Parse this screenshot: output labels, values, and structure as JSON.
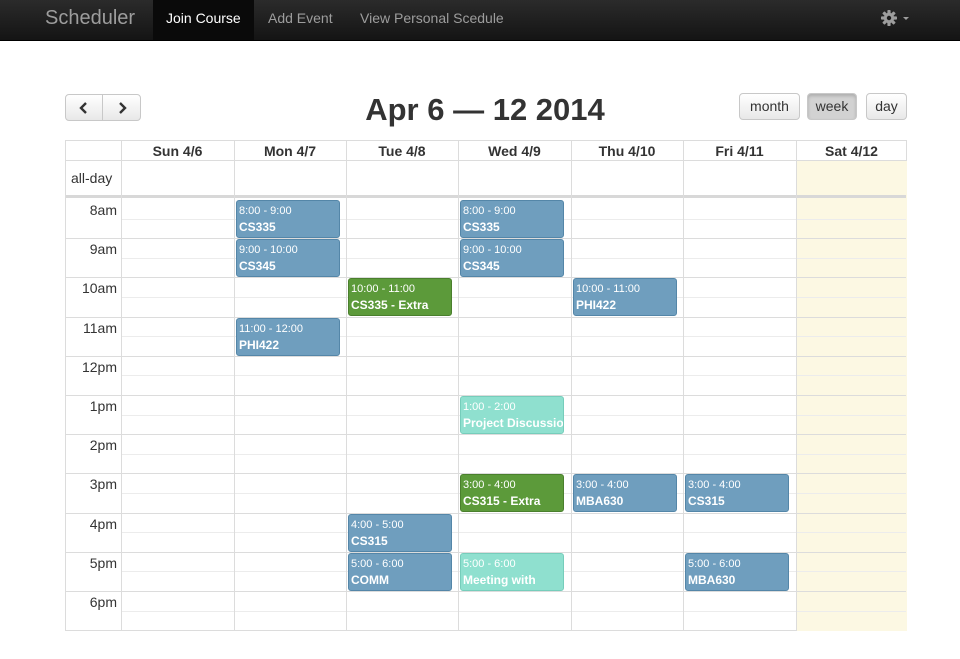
{
  "navbar": {
    "brand": "Scheduler",
    "items": [
      {
        "label": "Join Course",
        "active": true
      },
      {
        "label": "Add Event",
        "active": false
      },
      {
        "label": "View Personal Scedule",
        "active": false
      }
    ],
    "settings_icon": "gear-icon",
    "dropdown_icon": "caret-down-icon"
  },
  "toolbar": {
    "prev_icon": "chevron-left-icon",
    "next_icon": "chevron-right-icon",
    "title": "Apr 6 — 12 2014",
    "views": [
      {
        "label": "month",
        "active": false
      },
      {
        "label": "week",
        "active": true
      },
      {
        "label": "day",
        "active": false
      }
    ]
  },
  "calendar": {
    "days": [
      "Sun 4/6",
      "Mon 4/7",
      "Tue 4/8",
      "Wed 4/9",
      "Thu 4/10",
      "Fri 4/11",
      "Sat 4/12"
    ],
    "today": "Sat 4/12",
    "today_color": "#fcf8e3",
    "allday_label": "all-day",
    "hours": [
      "8am",
      "9am",
      "10am",
      "11am",
      "12pm",
      "1pm",
      "2pm",
      "3pm",
      "4pm",
      "5pm",
      "6pm"
    ],
    "events": [
      {
        "day": 1,
        "start": 8,
        "end": 9,
        "time": "8:00 - 9:00",
        "title": "CS335",
        "color": "blue"
      },
      {
        "day": 1,
        "start": 9,
        "end": 10,
        "time": "9:00 - 10:00",
        "title": "CS345",
        "color": "blue"
      },
      {
        "day": 1,
        "start": 11,
        "end": 12,
        "time": "11:00 - 12:00",
        "title": "PHI422",
        "color": "blue"
      },
      {
        "day": 2,
        "start": 10,
        "end": 11,
        "time": "10:00 - 11:00",
        "title": "CS335 - Extra",
        "color": "green"
      },
      {
        "day": 2,
        "start": 16,
        "end": 17,
        "time": "4:00 - 5:00",
        "title": "CS315",
        "color": "blue"
      },
      {
        "day": 2,
        "start": 17,
        "end": 18,
        "time": "5:00 - 6:00",
        "title": "COMM",
        "color": "blue"
      },
      {
        "day": 3,
        "start": 8,
        "end": 9,
        "time": "8:00 - 9:00",
        "title": "CS335",
        "color": "blue"
      },
      {
        "day": 3,
        "start": 9,
        "end": 10,
        "time": "9:00 - 10:00",
        "title": "CS345",
        "color": "blue"
      },
      {
        "day": 3,
        "start": 13,
        "end": 14,
        "time": "1:00 - 2:00",
        "title": "Project Discussion",
        "color": "teal"
      },
      {
        "day": 3,
        "start": 15,
        "end": 16,
        "time": "3:00 - 4:00",
        "title": "CS315 - Extra",
        "color": "green"
      },
      {
        "day": 3,
        "start": 17,
        "end": 18,
        "time": "5:00 - 6:00",
        "title": "Meeting with",
        "color": "teal"
      },
      {
        "day": 4,
        "start": 10,
        "end": 11,
        "time": "10:00 - 11:00",
        "title": "PHI422",
        "color": "blue"
      },
      {
        "day": 4,
        "start": 15,
        "end": 16,
        "time": "3:00 - 4:00",
        "title": "MBA630",
        "color": "blue"
      },
      {
        "day": 5,
        "start": 15,
        "end": 16,
        "time": "3:00 - 4:00",
        "title": "CS315",
        "color": "blue"
      },
      {
        "day": 5,
        "start": 17,
        "end": 18,
        "time": "5:00 - 6:00",
        "title": "MBA630",
        "color": "blue"
      }
    ]
  },
  "colors": {
    "blue": "#6f9ebe",
    "green": "#5c9a3a",
    "teal": "#8fe0cf",
    "navbar": "#1b1b1b"
  }
}
